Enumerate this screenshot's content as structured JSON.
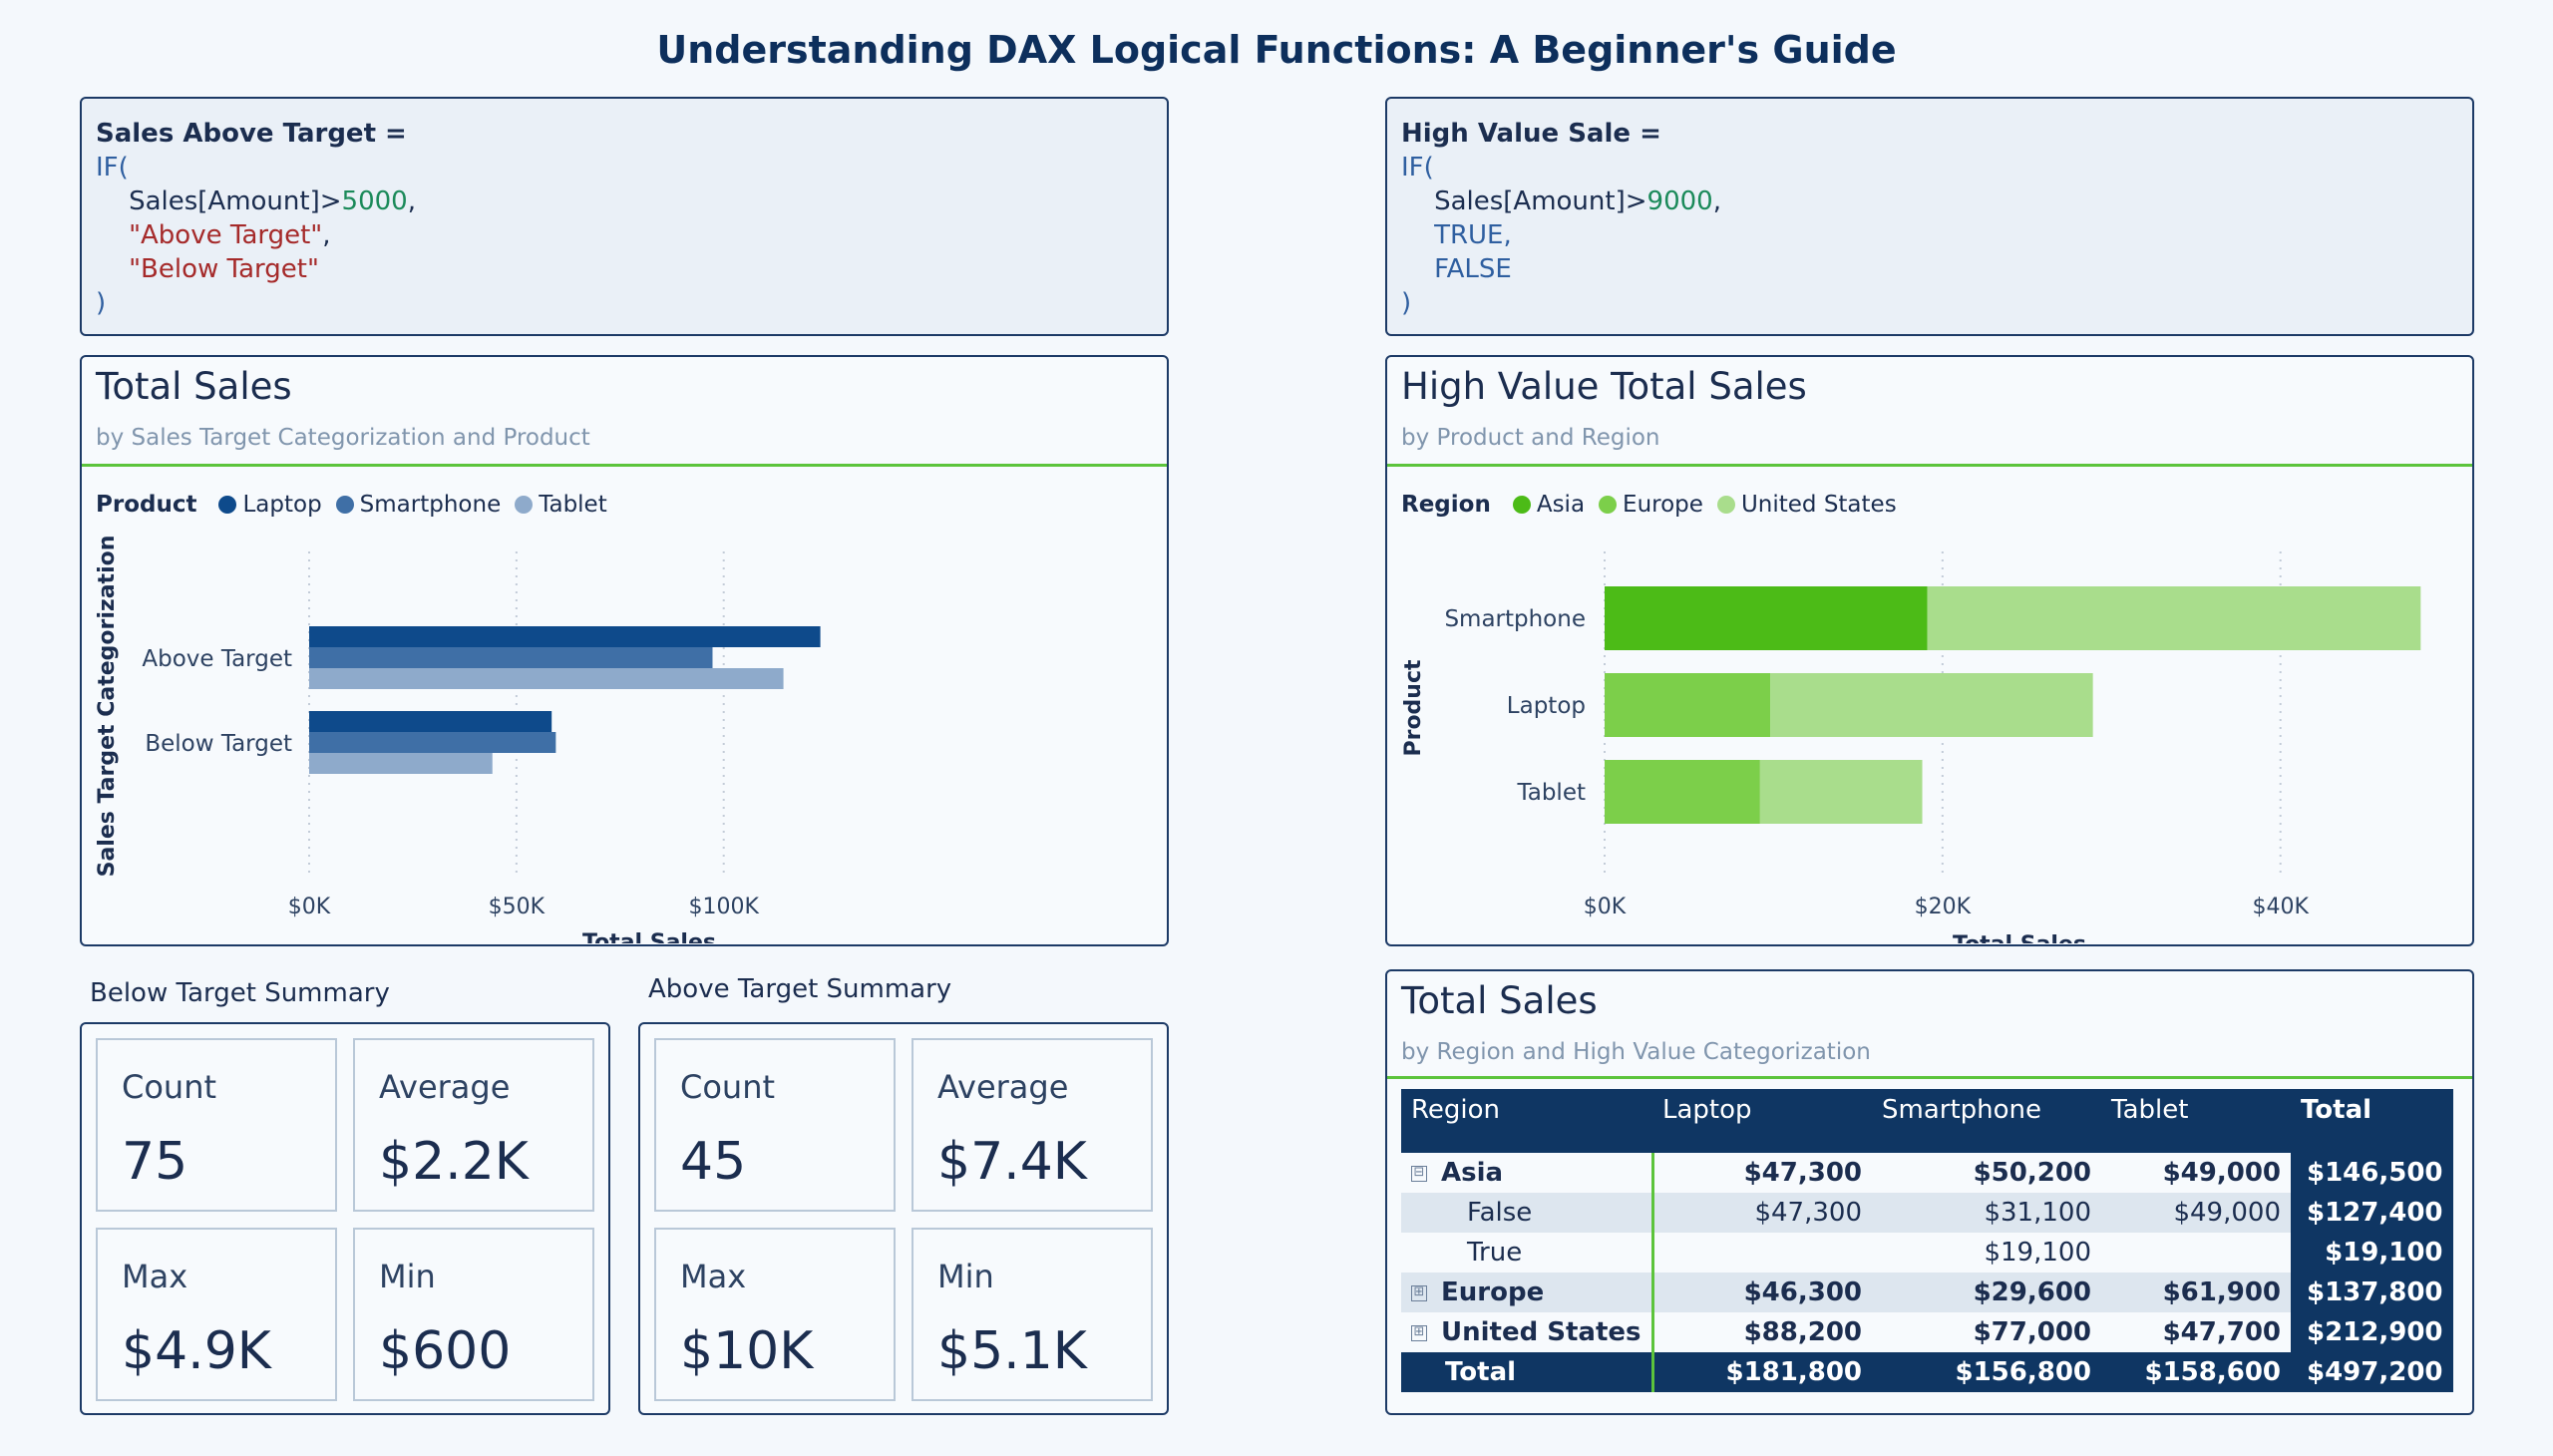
{
  "page_title": "Understanding DAX Logical Functions: A Beginner's Guide",
  "code_left": {
    "header": "Sales Above Target =",
    "if_kw": "IF(",
    "field": "Sales[Amount]",
    "op": ">",
    "threshold": "5000",
    "comma": ",",
    "true_val": "\"Above Target\"",
    "false_val": "\"Below Target\"",
    "close": ")"
  },
  "code_right": {
    "header": "High Value Sale =",
    "if_kw": "IF(",
    "field": "Sales[Amount]",
    "op": ">",
    "threshold": "9000",
    "comma": ",",
    "true_val": "TRUE,",
    "false_val": "FALSE",
    "close": ")"
  },
  "chart_left": {
    "title": "Total Sales",
    "subtitle": "by Sales Target Categorization and Product",
    "legend_title": "Product"
  },
  "chart_right": {
    "title": "High Value Total Sales",
    "subtitle": "by Product and Region",
    "legend_title": "Region"
  },
  "chart_data": [
    {
      "type": "bar",
      "orientation": "horizontal",
      "title": "Total Sales",
      "subtitle": "by Sales Target Categorization and Product",
      "categories": [
        "Above Target",
        "Below Target"
      ],
      "series": [
        {
          "name": "Laptop",
          "color": "#0e4a8b",
          "values": [
            123300,
            58500
          ]
        },
        {
          "name": "Smartphone",
          "color": "#3f6fa6",
          "values": [
            97300,
            59500
          ]
        },
        {
          "name": "Tablet",
          "color": "#8eaacb",
          "values": [
            114400,
            44200
          ]
        }
      ],
      "xlabel": "Total Sales",
      "ylabel": "Sales Target Categorization",
      "xlim": [
        0,
        140000
      ],
      "xticks": [
        0,
        50000,
        100000
      ],
      "xtick_labels": [
        "$0K",
        "$50K",
        "$100K"
      ],
      "legend_title": "Product",
      "legend_position": "top-left",
      "grid": "vertical-dotted"
    },
    {
      "type": "bar",
      "orientation": "horizontal",
      "stacked": true,
      "title": "High Value Total Sales",
      "subtitle": "by Product and Region",
      "categories": [
        "Smartphone",
        "Laptop",
        "Tablet"
      ],
      "series": [
        {
          "name": "Asia",
          "color": "#4cbb17",
          "values": [
            19100,
            0,
            0
          ]
        },
        {
          "name": "Europe",
          "color": "#7ccf4a",
          "values": [
            0,
            9800,
            9200
          ]
        },
        {
          "name": "United States",
          "color": "#a9dd8c",
          "values": [
            29200,
            19100,
            9600
          ]
        }
      ],
      "xlabel": "Total Sales",
      "ylabel": "Product",
      "xlim": [
        0,
        52000
      ],
      "xticks": [
        0,
        20000,
        40000
      ],
      "xtick_labels": [
        "$0K",
        "$20K",
        "$40K"
      ],
      "legend_title": "Region",
      "legend_position": "top-left",
      "grid": "vertical-dotted"
    }
  ],
  "below_summary": {
    "title": "Below Target Summary",
    "tiles": [
      {
        "label": "Count",
        "value": "75"
      },
      {
        "label": "Average",
        "value": "$2.2K"
      },
      {
        "label": "Max",
        "value": "$4.9K"
      },
      {
        "label": "Min",
        "value": "$600"
      }
    ]
  },
  "above_summary": {
    "title": "Above Target Summary",
    "tiles": [
      {
        "label": "Count",
        "value": "45"
      },
      {
        "label": "Average",
        "value": "$7.4K"
      },
      {
        "label": "Max",
        "value": "$10K"
      },
      {
        "label": "Min",
        "value": "$5.1K"
      }
    ]
  },
  "matrix": {
    "title": "Total Sales",
    "subtitle": "by Region and High Value Categorization",
    "headers": [
      "Region",
      "Laptop",
      "Smartphone",
      "Tablet",
      "Total"
    ],
    "rows": [
      {
        "label": "Asia",
        "expander": "⊟",
        "cells": [
          "$47,300",
          "$50,200",
          "$49,000",
          "$146,500"
        ]
      },
      {
        "label": "False",
        "cells": [
          "$47,300",
          "$31,100",
          "$49,000",
          "$127,400"
        ]
      },
      {
        "label": "True",
        "cells": [
          "",
          "$19,100",
          "",
          "$19,100"
        ]
      },
      {
        "label": "Europe",
        "expander": "⊞",
        "cells": [
          "$46,300",
          "$29,600",
          "$61,900",
          "$137,800"
        ]
      },
      {
        "label": "United States",
        "expander": "⊞",
        "cells": [
          "$88,200",
          "$77,000",
          "$47,700",
          "$212,900"
        ]
      },
      {
        "label": "Total",
        "cells": [
          "$181,800",
          "$156,800",
          "$158,600",
          "$497,200"
        ]
      }
    ]
  },
  "colors": {
    "accent_green": "#5cc43c",
    "navy": "#0f3663",
    "border": "#1c3a66"
  }
}
